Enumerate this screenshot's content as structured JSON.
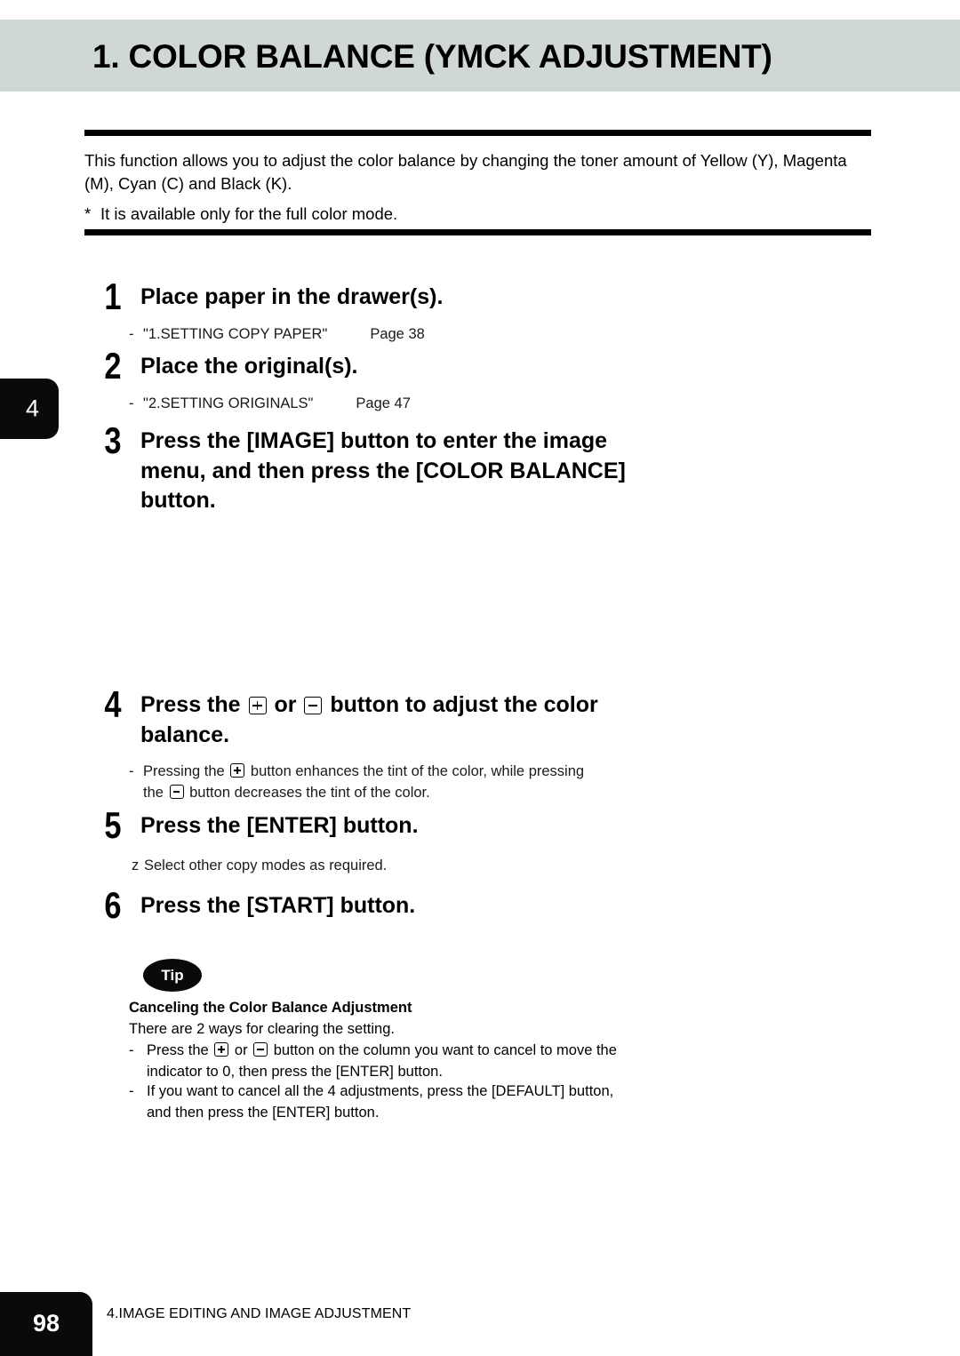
{
  "header": {
    "title": "1. COLOR BALANCE (YMCK ADJUSTMENT)",
    "band_color": "#d0d8d6"
  },
  "intro": {
    "paragraph": "This function allows you to adjust the color balance by changing the toner amount of Yellow (Y), Magenta (M), Cyan (C) and Black (K).",
    "note_marker": "*",
    "note": "It is available only for the full color mode."
  },
  "chapter_tab": {
    "number": "4"
  },
  "steps": [
    {
      "number": "1",
      "title": "Place paper in the drawer(s).",
      "reference": {
        "dash": "-",
        "title": "\"1.SETTING COPY PAPER\"",
        "page": "Page 38"
      }
    },
    {
      "number": "2",
      "title": "Place the original(s).",
      "reference": {
        "dash": "-",
        "title": "\"2.SETTING ORIGINALS\"",
        "page": "Page 47"
      }
    },
    {
      "number": "3",
      "title": "Press the [IMAGE] button to enter the image menu, and then press the [COLOR BALANCE] button."
    },
    {
      "number": "4",
      "title_part1": "Press the",
      "title_part2": "or",
      "title_part3": "button to adjust the color balance.",
      "note": {
        "dash": "-",
        "part1": "Pressing the",
        "part2": "button enhances the tint of the color, while pressing the",
        "part3": "button decreases the tint of the color."
      }
    },
    {
      "number": "5",
      "title": "Press the [ENTER] button.",
      "note": {
        "bullet": "z",
        "text": "Select other copy modes as required."
      }
    },
    {
      "number": "6",
      "title": "Press the [START] button."
    }
  ],
  "tip": {
    "badge": "Tip",
    "heading": "Canceling the Color Balance Adjustment",
    "intro": "There are 2 ways for clearing the setting.",
    "items": [
      {
        "dash": "-",
        "part1": "Press the",
        "part2": "or",
        "part3": "button on the column you want to cancel to move the indicator to 0, then press the [ENTER] button."
      },
      {
        "dash": "-",
        "text": "If you want to cancel all the 4 adjustments, press the [DEFAULT] button, and then press the [ENTER] button."
      }
    ]
  },
  "footer": {
    "page_number": "98",
    "section": "4.IMAGE EDITING AND IMAGE ADJUSTMENT"
  },
  "icons": {
    "plus_key": "plus-key-icon",
    "minus_key": "minus-key-icon"
  }
}
